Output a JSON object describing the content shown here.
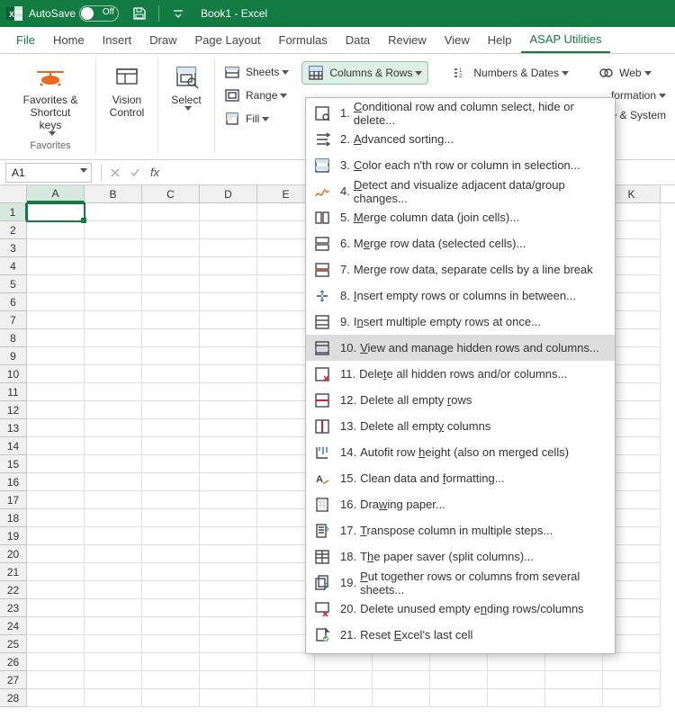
{
  "titlebar": {
    "autosave_label": "AutoSave",
    "autosave_state": "Off",
    "doc_title": "Book1 - Excel"
  },
  "tabs": {
    "file": "File",
    "home": "Home",
    "insert": "Insert",
    "draw": "Draw",
    "page_layout": "Page Layout",
    "formulas": "Formulas",
    "data": "Data",
    "review": "Review",
    "view": "View",
    "help": "Help",
    "asap": "ASAP Utilities"
  },
  "ribbon": {
    "favorites_btn": "Favorites &\nShortcut keys",
    "favorites_group": "Favorites",
    "vision_btn": "Vision\nControl",
    "select_btn": "Select",
    "sheets_btn": "Sheets",
    "range_btn": "Range",
    "fill_btn": "Fill",
    "columns_rows_btn": "Columns & Rows",
    "numbers_dates_btn": "Numbers & Dates",
    "web_btn": "Web",
    "information_btn": "formation",
    "file_system_btn": "le & System"
  },
  "formula": {
    "name_box": "A1",
    "fx_label": "fx"
  },
  "grid": {
    "columns": [
      "A",
      "B",
      "C",
      "D",
      "E",
      "",
      "",
      "",
      "",
      "",
      "K"
    ],
    "rows": 28,
    "active_cell": "A1",
    "selected_col_index": 0,
    "selected_row_index": 0
  },
  "dropdown": {
    "highlighted_index": 9,
    "items": [
      {
        "num": "1.",
        "label": "Conditional row and column select, hide or delete...",
        "u": 0
      },
      {
        "num": "2.",
        "label": "Advanced sorting...",
        "u": 0
      },
      {
        "num": "3.",
        "label": "Color each n'th row or column in selection...",
        "u": 0
      },
      {
        "num": "4.",
        "label": "Detect and visualize adjacent data/group changes...",
        "u": 0
      },
      {
        "num": "5.",
        "label": "Merge column data (join cells)...",
        "u": 0
      },
      {
        "num": "6.",
        "label": "Merge row data (selected cells)...",
        "u": 1
      },
      {
        "num": "7.",
        "label": "Merge row data, separate cells by a line break",
        "u": 3
      },
      {
        "num": "8.",
        "label": "Insert empty rows or columns in between...",
        "u": 0
      },
      {
        "num": "9.",
        "label": "Insert multiple empty rows at once...",
        "u": 1
      },
      {
        "num": "10.",
        "label": "View and manage hidden rows and columns...",
        "u": 0
      },
      {
        "num": "11.",
        "label": "Delete all hidden rows and/or columns...",
        "u": 4
      },
      {
        "num": "12.",
        "label": "Delete all empty rows",
        "u": 17
      },
      {
        "num": "13.",
        "label": "Delete all empty columns",
        "u": 15
      },
      {
        "num": "14.",
        "label": "Autofit row height (also on merged cells)",
        "u": 12
      },
      {
        "num": "15.",
        "label": "Clean data and formatting...",
        "u": 15
      },
      {
        "num": "16.",
        "label": "Drawing paper...",
        "u": 3
      },
      {
        "num": "17.",
        "label": "Transpose column in multiple steps...",
        "u": 0
      },
      {
        "num": "18.",
        "label": "The paper saver (split columns)...",
        "u": 1
      },
      {
        "num": "19.",
        "label": "Put together rows or columns from several sheets...",
        "u": 0
      },
      {
        "num": "20.",
        "label": "Delete unused empty ending rows/columns",
        "u": 21
      },
      {
        "num": "21.",
        "label": "Reset Excel's last cell",
        "u": 6
      }
    ]
  }
}
